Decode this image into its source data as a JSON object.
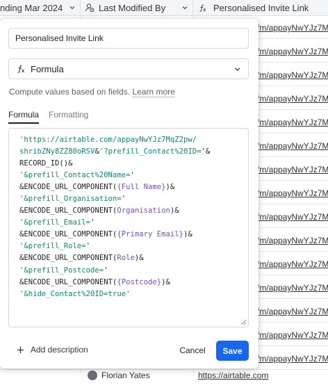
{
  "grid": {
    "columns": [
      {
        "label": "nding Mar 2024"
      },
      {
        "label": "Last Modified By",
        "icon": "user-clock-icon"
      },
      {
        "label": "Personalised Invite Link",
        "icon": "formula-icon"
      }
    ],
    "row_url_text": "/m/appayNwYJz7M",
    "bottom_row_name": "Florian Yates",
    "bottom_row_url": "https://airtable.com"
  },
  "dialog": {
    "field_name_value": "Personalised Invite Link",
    "field_type_label": "Formula",
    "description_text": "Compute values based on fields.",
    "learn_more_label": "Learn more",
    "tabs": [
      {
        "label": "Formula",
        "active": true
      },
      {
        "label": "Formatting",
        "active": false
      }
    ],
    "formula_lines": [
      [
        {
          "t": "s",
          "v": "'https://airtable.com/appayNwYJz7MqZ2pw/"
        }
      ],
      [
        {
          "t": "s",
          "v": "shribZNy8ZZ80oRSV"
        },
        {
          "t": "p",
          "v": "&"
        },
        {
          "t": "s",
          "v": "'?prefill_Contact%20ID="
        },
        {
          "t": "p",
          "v": "'&"
        }
      ],
      [
        {
          "t": "f",
          "v": "RECORD_ID"
        },
        {
          "t": "p",
          "v": "()&"
        }
      ],
      [
        {
          "t": "s",
          "v": "'&prefill_Contact%20Name="
        },
        {
          "t": "p",
          "v": "'"
        }
      ],
      [
        {
          "t": "p",
          "v": "&"
        },
        {
          "t": "f",
          "v": "ENCODE_URL_COMPONENT"
        },
        {
          "t": "p",
          "v": "("
        },
        {
          "t": "d",
          "v": "{Full Name}"
        },
        {
          "t": "p",
          "v": ")&"
        }
      ],
      [
        {
          "t": "s",
          "v": "'&prefill_Organisation="
        },
        {
          "t": "p",
          "v": "'"
        }
      ],
      [
        {
          "t": "p",
          "v": "&"
        },
        {
          "t": "f",
          "v": "ENCODE_URL_COMPONENT"
        },
        {
          "t": "p",
          "v": "("
        },
        {
          "t": "d",
          "v": "Organisation"
        },
        {
          "t": "p",
          "v": ")&"
        }
      ],
      [
        {
          "t": "s",
          "v": "'&prefill_Email="
        },
        {
          "t": "p",
          "v": "'"
        }
      ],
      [
        {
          "t": "p",
          "v": "&"
        },
        {
          "t": "f",
          "v": "ENCODE_URL_COMPONENT"
        },
        {
          "t": "p",
          "v": "("
        },
        {
          "t": "d",
          "v": "{Primary Email}"
        },
        {
          "t": "p",
          "v": ")&"
        }
      ],
      [
        {
          "t": "s",
          "v": "'&prefill_Role="
        },
        {
          "t": "p",
          "v": "'"
        }
      ],
      [
        {
          "t": "p",
          "v": "&"
        },
        {
          "t": "f",
          "v": "ENCODE_URL_COMPONENT"
        },
        {
          "t": "p",
          "v": "("
        },
        {
          "t": "d",
          "v": "Role"
        },
        {
          "t": "p",
          "v": ")&"
        }
      ],
      [
        {
          "t": "s",
          "v": "'&prefill_Postcode="
        },
        {
          "t": "p",
          "v": "'"
        }
      ],
      [
        {
          "t": "p",
          "v": "&"
        },
        {
          "t": "f",
          "v": "ENCODE_URL_COMPONENT"
        },
        {
          "t": "p",
          "v": "("
        },
        {
          "t": "d",
          "v": "{Postcode}"
        },
        {
          "t": "p",
          "v": ")&"
        }
      ],
      [
        {
          "t": "s",
          "v": "'&hide_Contact%20ID=true'"
        }
      ]
    ],
    "add_description_label": "Add description",
    "cancel_label": "Cancel",
    "save_label": "Save",
    "colors": {
      "save_button": "#1666ee",
      "formula_string": "#0a8a78",
      "formula_field": "#7c4dbd"
    }
  }
}
